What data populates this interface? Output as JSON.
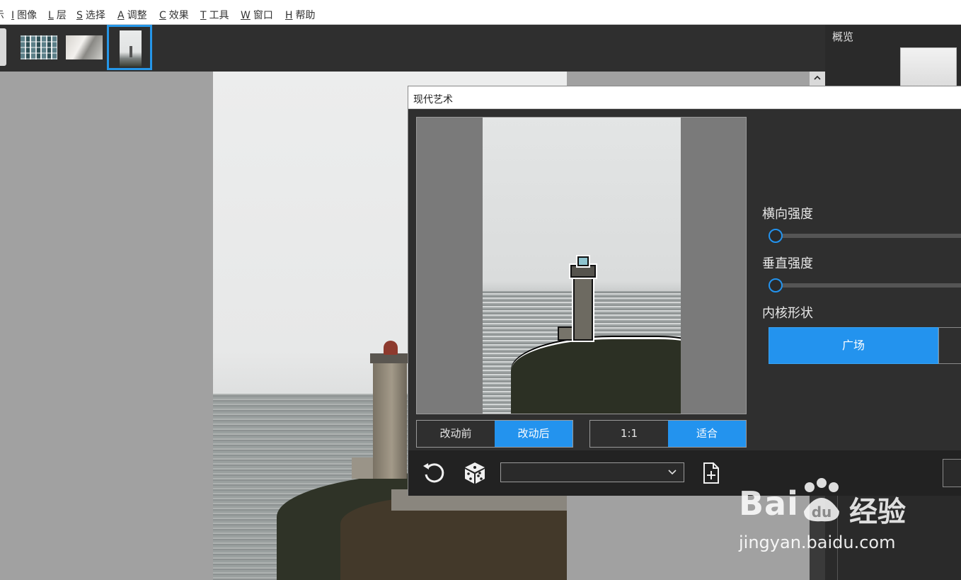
{
  "menubar": {
    "items": [
      {
        "key": "",
        "label": "示"
      },
      {
        "key": "I",
        "label": "图像"
      },
      {
        "key": "L",
        "label": "层"
      },
      {
        "key": "S",
        "label": "选择"
      },
      {
        "key": "A",
        "label": "调整"
      },
      {
        "key": "C",
        "label": "效果"
      },
      {
        "key": "T",
        "label": "工具"
      },
      {
        "key": "W",
        "label": "窗口"
      },
      {
        "key": "H",
        "label": "帮助"
      }
    ]
  },
  "side_panel": {
    "title": "概览"
  },
  "dialog": {
    "title": "现代艺术",
    "view_toggle": {
      "before": "改动前",
      "after": "改动后",
      "selected": "改动后"
    },
    "zoom_toggle": {
      "actual": "1:1",
      "fit": "适合",
      "selected": "适合"
    },
    "params": {
      "horizontal_strength": {
        "label": "横向强度",
        "value": 0
      },
      "vertical_strength": {
        "label": "垂直强度",
        "value": 0
      },
      "kernel_shape": {
        "label": "内核形状",
        "selected": "广场"
      }
    },
    "footer": {
      "reset_icon": "reset-icon",
      "dice_icon": "dice-icon",
      "preset_value": "",
      "new_preset_icon": "new-file-icon"
    }
  },
  "watermark": {
    "brand": "Bai",
    "brand_suffix": "du",
    "cn": "经验",
    "url": "jingyan.baidu.com"
  },
  "colors": {
    "accent": "#2393ee",
    "dialog_bg": "#2f2f2f",
    "canvas_bg": "#a1a1a1"
  }
}
